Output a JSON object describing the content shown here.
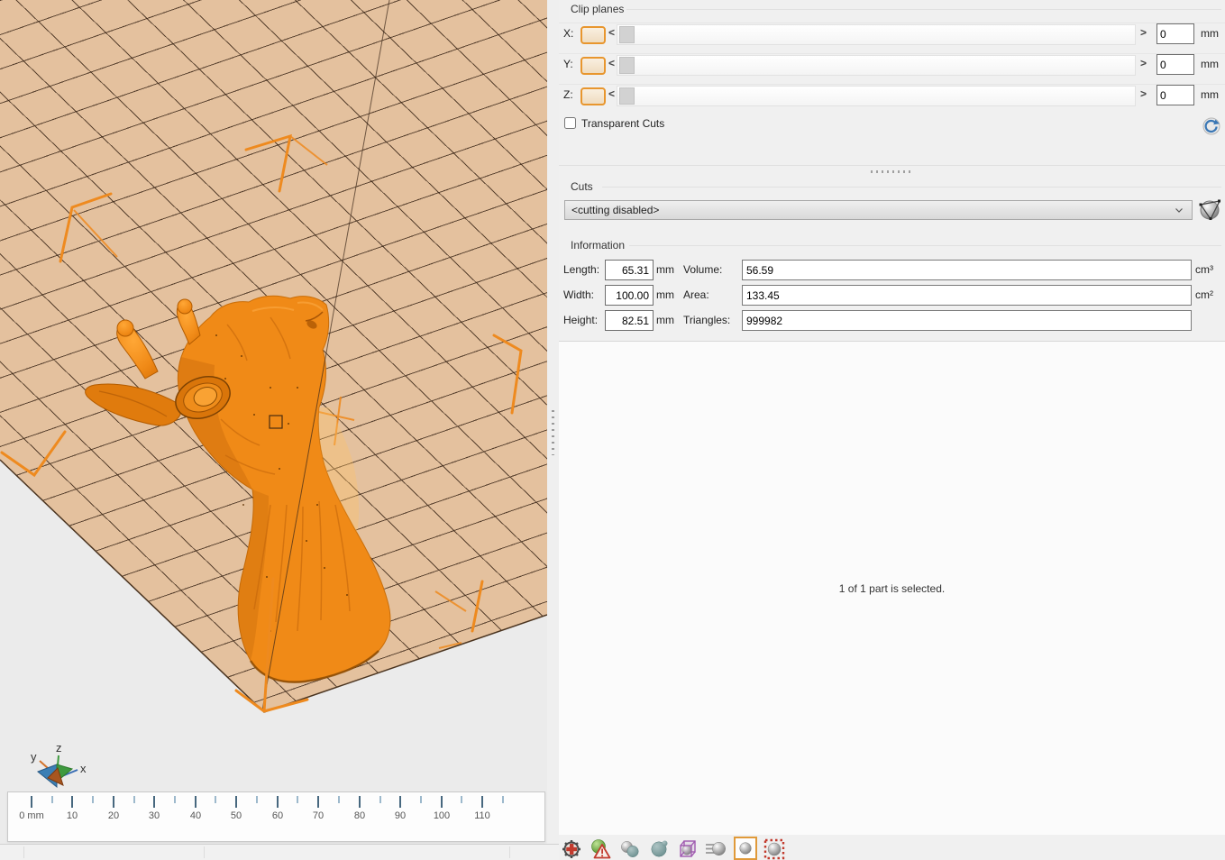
{
  "viewport": {
    "ruler_labels": [
      "0 mm",
      "10",
      "20",
      "30",
      "40",
      "50",
      "60",
      "70",
      "80",
      "90",
      "100",
      "110"
    ],
    "axis_labels": {
      "x": "x",
      "y": "y",
      "z": "z"
    }
  },
  "clip_planes": {
    "title": "Clip planes",
    "decrease_glyph": "<",
    "increase_glyph": ">",
    "rows": [
      {
        "label": "X:",
        "value": "0",
        "unit": "mm"
      },
      {
        "label": "Y:",
        "value": "0",
        "unit": "mm"
      },
      {
        "label": "Z:",
        "value": "0",
        "unit": "mm"
      }
    ],
    "transparent_cuts_label": "Transparent Cuts"
  },
  "cuts": {
    "title": "Cuts",
    "selected_option": "<cutting disabled>"
  },
  "information": {
    "title": "Information",
    "length": {
      "label": "Length:",
      "value": "65.31",
      "unit": "mm"
    },
    "width": {
      "label": "Width:",
      "value": "100.00",
      "unit": "mm"
    },
    "height": {
      "label": "Height:",
      "value": "82.51",
      "unit": "mm"
    },
    "volume": {
      "label": "Volume:",
      "value": "56.59",
      "unit": "cm³"
    },
    "area": {
      "label": "Area:",
      "value": "133.45",
      "unit": "cm²"
    },
    "triangles": {
      "label": "Triangles:",
      "value": "999982",
      "unit": ""
    }
  },
  "parts_panel": {
    "status_text": "1 of 1 part is selected."
  },
  "toolbar": {
    "icons": [
      "repair-part",
      "part-warning",
      "spheres-pair",
      "sphere-rotate",
      "cube-sphere",
      "sphere-motion",
      "sphere-shaded",
      "sphere-selection"
    ],
    "active_icon": "sphere-shaded"
  },
  "colors": {
    "model": "#f08a17",
    "platform": "#e4c19e",
    "accent": "#e8962e",
    "panel_bg": "#f0f0f0"
  }
}
